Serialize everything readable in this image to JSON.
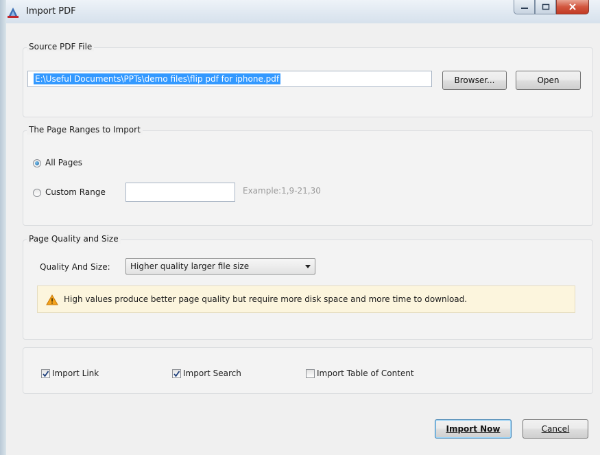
{
  "window": {
    "title": "Import PDF",
    "app_icon": "pdf-import-icon",
    "controls": [
      "minimize-icon",
      "maximize-icon",
      "close-icon"
    ]
  },
  "source": {
    "group_title": "Source PDF File",
    "path_value": "E:\\Useful Documents\\PPTs\\demo files\\flip pdf for iphone.pdf",
    "browse_label": "Browser...",
    "open_label": "Open"
  },
  "page_ranges": {
    "group_title": "The Page Ranges to Import",
    "all_pages_label": "All Pages",
    "all_pages_selected": true,
    "custom_range_label": "Custom Range",
    "custom_range_value": "",
    "example_hint": "Example:1,9-21,30"
  },
  "quality": {
    "group_title": "Page Quality and Size",
    "label": "Quality And Size:",
    "selected_option": "Higher quality larger file size",
    "warning_icon": "warning-icon",
    "warning_text": "High values produce better page quality but require more disk space and more time to download."
  },
  "options": {
    "import_link_label": "Import Link",
    "import_link_checked": true,
    "import_search_label": "Import Search",
    "import_search_checked": true,
    "import_toc_label": "Import Table of Content",
    "import_toc_checked": false
  },
  "footer": {
    "import_now_label": "Import Now",
    "cancel_label": "Cancel"
  }
}
